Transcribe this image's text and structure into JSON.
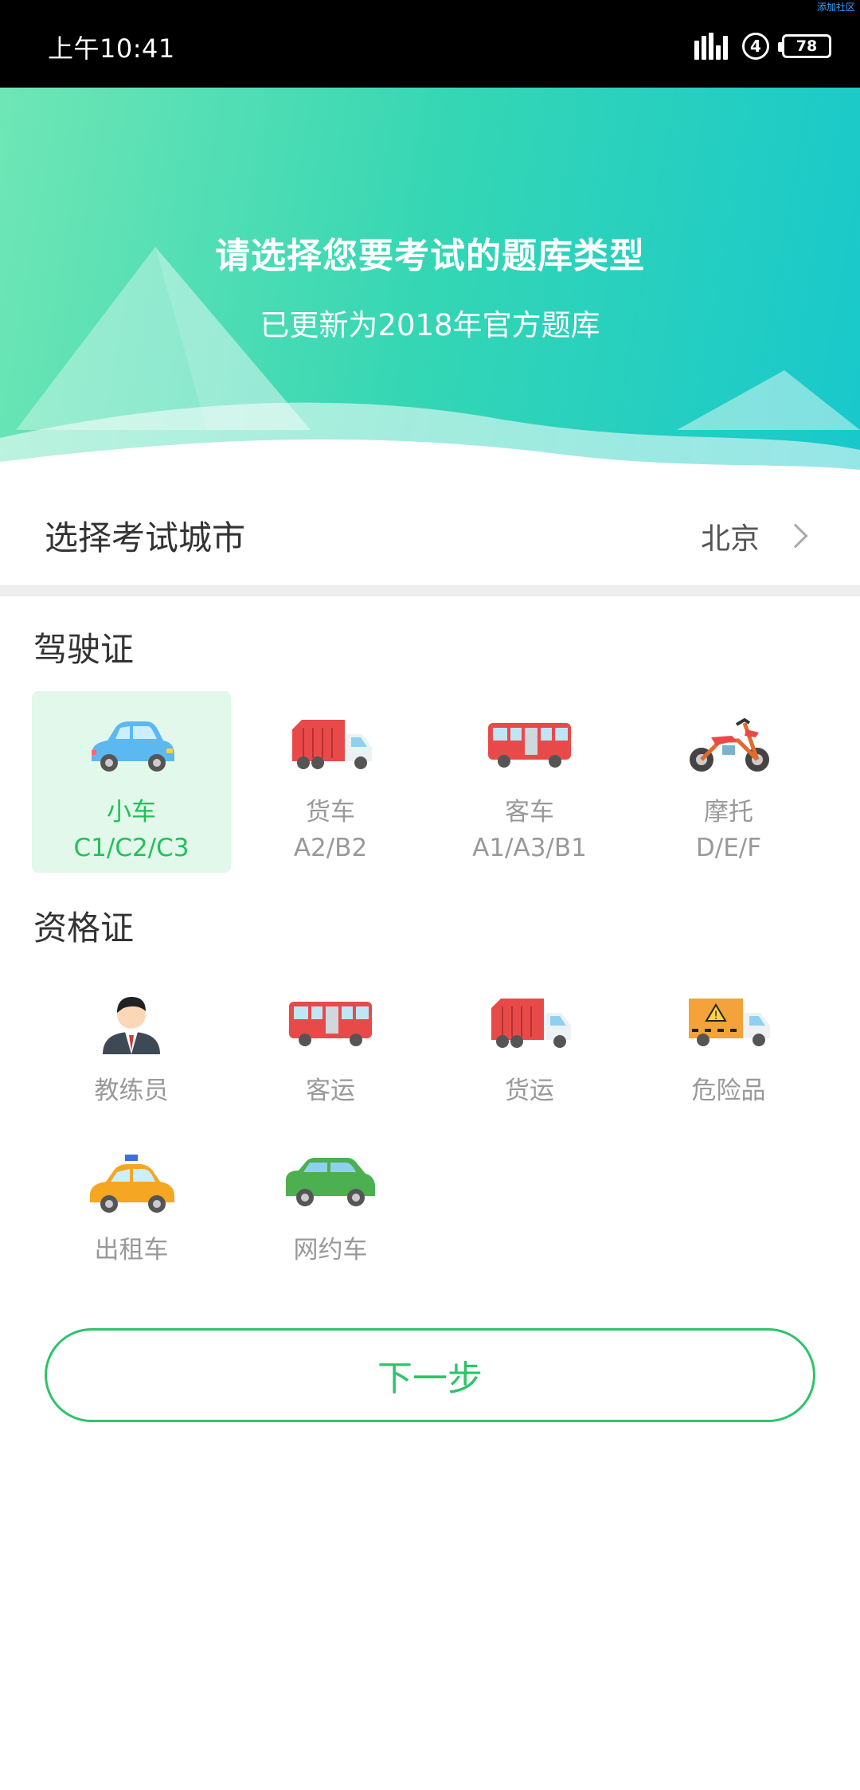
{
  "status_bar": {
    "time": "上午10:41",
    "sim_number": "4",
    "battery": "78",
    "corner_text": "添加社区"
  },
  "hero": {
    "title": "请选择您要考试的题库类型",
    "subtitle": "已更新为2018年官方题库"
  },
  "city": {
    "label": "选择考试城市",
    "value": "北京"
  },
  "license_section": {
    "title": "驾驶证",
    "items": [
      {
        "name": "小车",
        "code": "C1/C2/C3",
        "icon": "car-icon",
        "selected": true
      },
      {
        "name": "货车",
        "code": "A2/B2",
        "icon": "truck-icon",
        "selected": false
      },
      {
        "name": "客车",
        "code": "A1/A3/B1",
        "icon": "bus-icon",
        "selected": false
      },
      {
        "name": "摩托",
        "code": "D/E/F",
        "icon": "motorcycle-icon",
        "selected": false
      }
    ]
  },
  "qualification_section": {
    "title": "资格证",
    "items": [
      {
        "name": "教练员",
        "icon": "coach-icon"
      },
      {
        "name": "客运",
        "icon": "bus-icon"
      },
      {
        "name": "货运",
        "icon": "truck-icon"
      },
      {
        "name": "危险品",
        "icon": "hazmat-truck-icon"
      },
      {
        "name": "出租车",
        "icon": "taxi-icon"
      },
      {
        "name": "网约车",
        "icon": "rideshare-car-icon"
      }
    ]
  },
  "next_button": {
    "label": "下一步"
  },
  "colors": {
    "accent": "#2dc46a",
    "selected_bg": "#e2f8ea",
    "hero_from": "#6fe6b5",
    "hero_to": "#18c8cb"
  }
}
